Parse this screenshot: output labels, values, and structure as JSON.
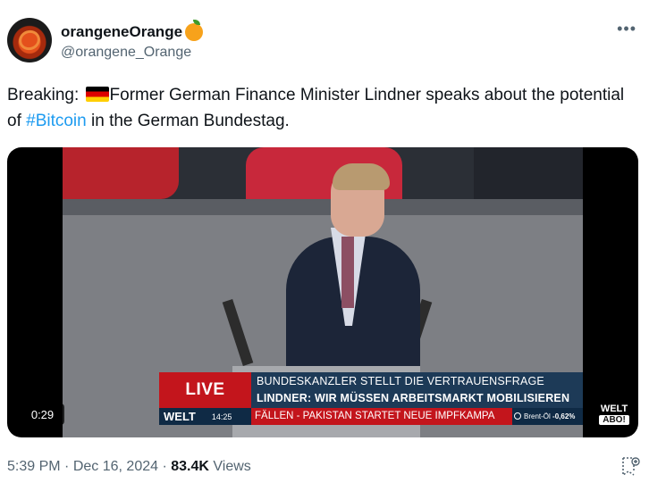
{
  "author": {
    "display_name": "orangeneOrange",
    "emoji": "orange-emoji",
    "handle": "@orangene_Orange"
  },
  "tweet": {
    "text_prefix": "Breaking: ",
    "flag": "german-flag-emoji",
    "text_main": "Former German Finance Minister Lindner speaks about the potential of ",
    "hashtag": "#Bitcoin",
    "text_suffix": " in the German Bundestag."
  },
  "video": {
    "duration": "0:29",
    "live_label": "LIVE",
    "channel": "WELT",
    "clock": "14:25",
    "headline_1": "BUNDESKANZLER STELLT DIE VERTRAUENSFRAGE",
    "headline_2": "LINDNER: WIR MÜSSEN ARBEITSMARKT MOBILISIEREN",
    "ticker": "FÄLLEN - PAKISTAN STARTET NEUE IMPFKAMPA",
    "stock_name": "Brent-Öl",
    "stock_change": "-0,62%",
    "watermark_1": "WELT",
    "watermark_2": "ABO!"
  },
  "meta": {
    "time": "5:39 PM",
    "date": "Dec 16, 2024",
    "views_count": "83.4K",
    "views_label": "Views",
    "separator": "·"
  },
  "colors": {
    "text": "#0f1419",
    "secondary": "#536471",
    "link": "#1d9bf0",
    "live_red": "#c3151c",
    "lower_third_blue": "#1d3a57"
  }
}
